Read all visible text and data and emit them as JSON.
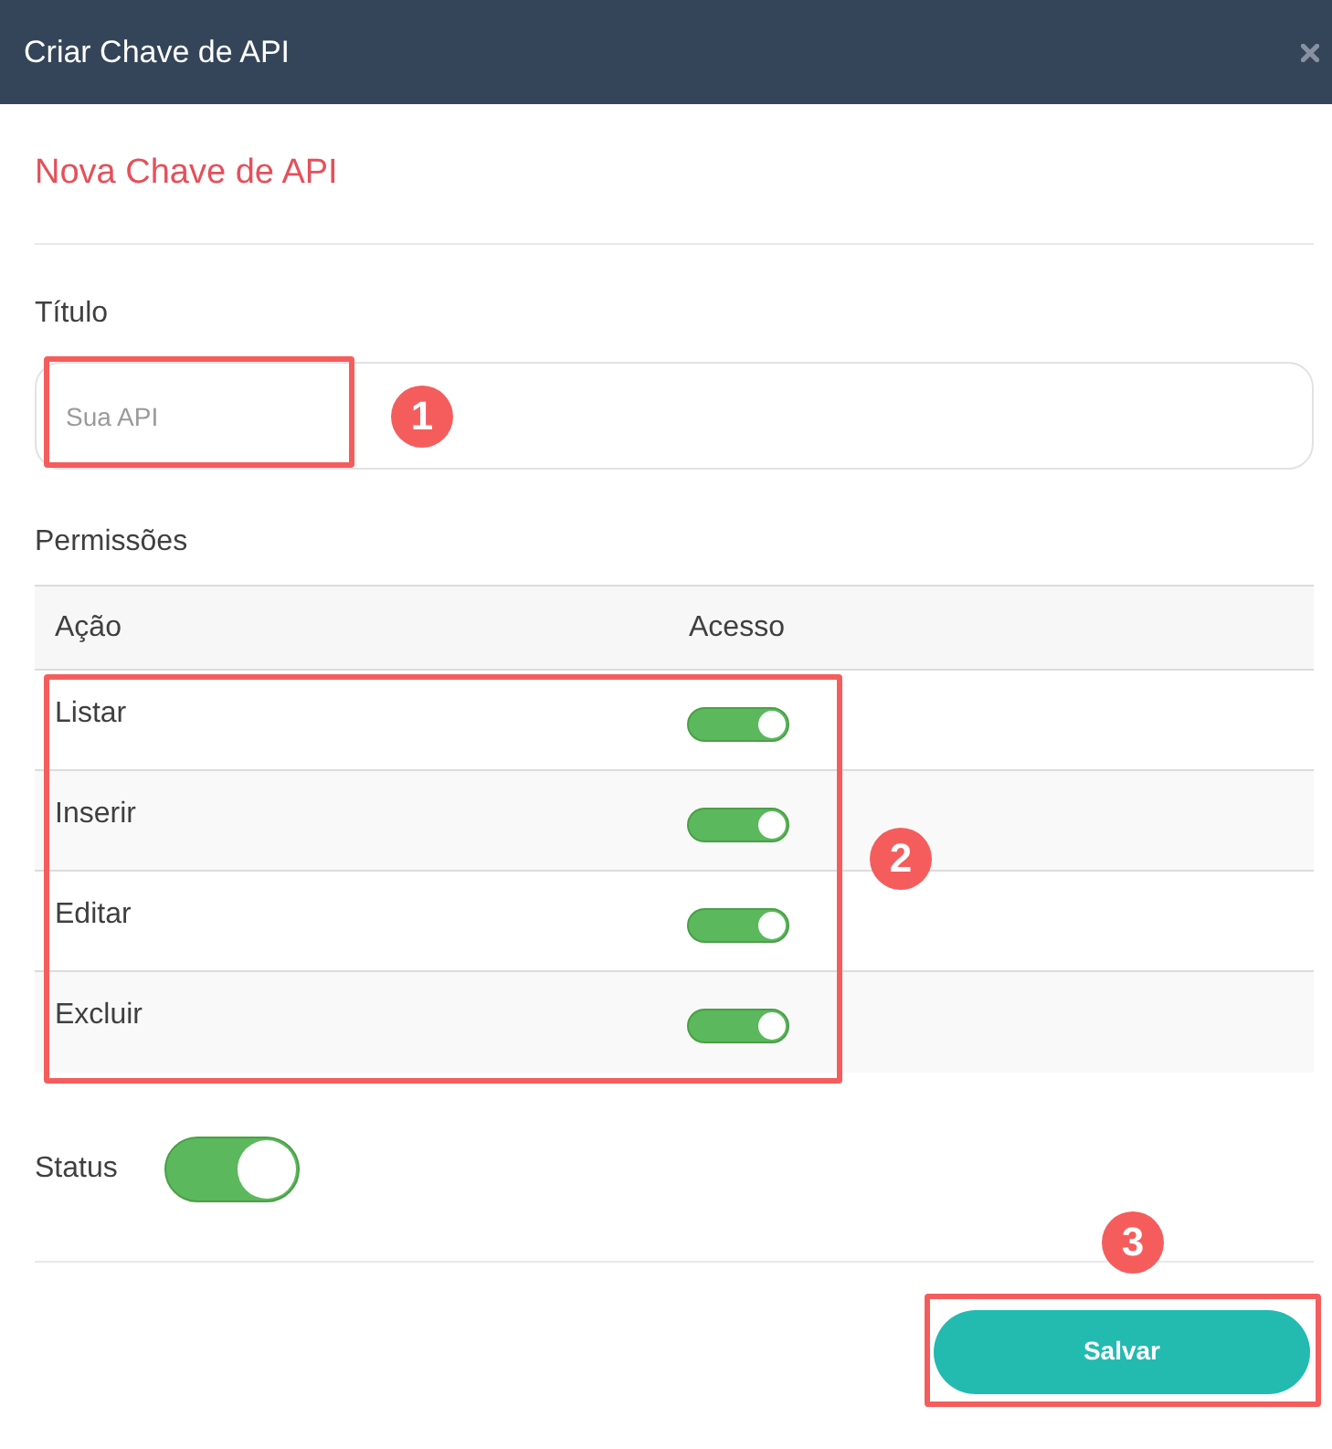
{
  "modal": {
    "title": "Criar Chave de API"
  },
  "section_title": "Nova Chave de API",
  "title_field": {
    "label": "Título",
    "placeholder": "Sua API",
    "callout": "1"
  },
  "permissions": {
    "label": "Permissões",
    "columns": [
      "Ação",
      "Acesso"
    ],
    "callout": "2",
    "rows": [
      {
        "action": "Listar",
        "on": true
      },
      {
        "action": "Inserir",
        "on": true
      },
      {
        "action": "Editar",
        "on": true
      },
      {
        "action": "Excluir",
        "on": true
      }
    ]
  },
  "status": {
    "label": "Status",
    "on": true
  },
  "save_button": {
    "label": "Salvar",
    "callout": "3"
  }
}
